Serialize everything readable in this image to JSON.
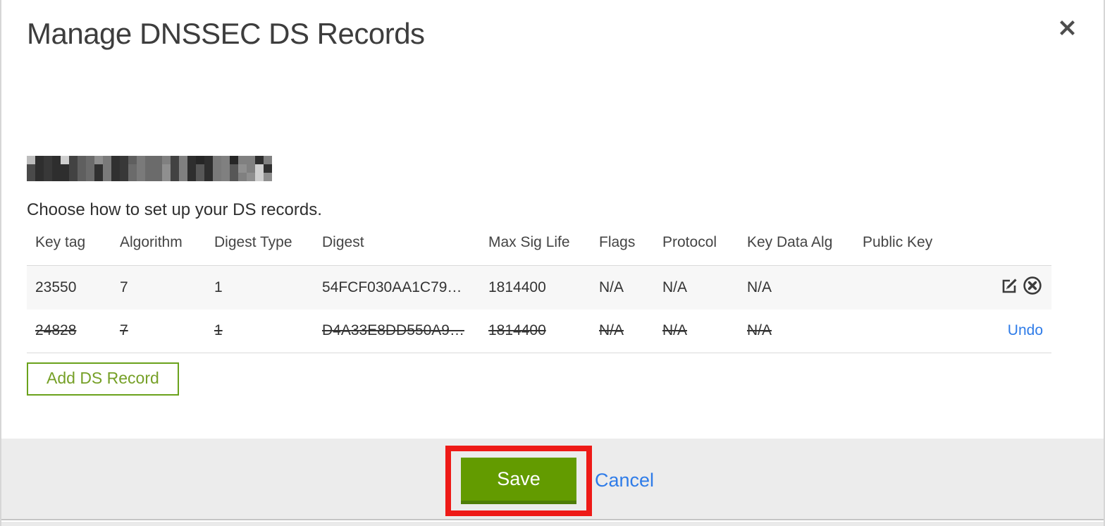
{
  "modal": {
    "title": "Manage DNSSEC DS Records"
  },
  "domain": {
    "redacted": true
  },
  "instruction": "Choose how to set up your DS records.",
  "table": {
    "headers": [
      "Key tag",
      "Algorithm",
      "Digest Type",
      "Digest",
      "Max Sig Life",
      "Flags",
      "Protocol",
      "Key Data Alg",
      "Public Key"
    ],
    "rows": [
      {
        "state": "active",
        "cells": [
          "23550",
          "7",
          "1",
          "54FCF030AA1C79…",
          "1814400",
          "N/A",
          "N/A",
          "N/A",
          ""
        ],
        "actions": [
          "edit",
          "delete"
        ]
      },
      {
        "state": "deleted",
        "cells": [
          "24828",
          "7",
          "1",
          "D4A33E8DD550A9…",
          "1814400",
          "N/A",
          "N/A",
          "N/A",
          ""
        ],
        "action_label": "Undo"
      }
    ]
  },
  "buttons": {
    "add_ds_record": "Add DS Record",
    "save": "Save",
    "cancel": "Cancel"
  },
  "icons": {
    "close": "x-cross",
    "edit": "pencil-square",
    "delete": "circle-x"
  },
  "colors": {
    "save_green": "#639b00",
    "save_green_dark": "#4e7d08",
    "outline_green": "#6aa21c",
    "link_blue": "#2f7ce8",
    "annotation_red": "#ee1a17",
    "footer_gray": "#ececec",
    "row_gray": "#f7f7f7"
  }
}
